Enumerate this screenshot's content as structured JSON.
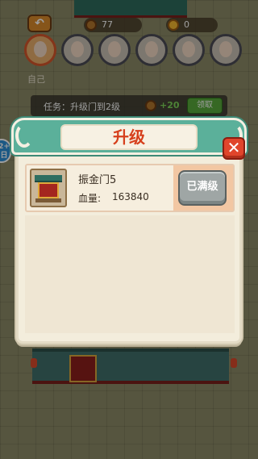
{
  "hud": {
    "back_icon": "arrow-left-icon",
    "coin_amount": "77",
    "gold_amount": "0",
    "self_label": "自己"
  },
  "task": {
    "text": "任务：升级门到2级",
    "reward": "+20",
    "claim_label": "领取"
  },
  "side_badge": {
    "line1": "2+",
    "line2": "日"
  },
  "modal": {
    "title": "升级",
    "close_icon": "close-icon"
  },
  "item": {
    "name": "振金门5",
    "hp_label": "血量:",
    "hp_value": "163840",
    "button_label": "已满级"
  },
  "colors": {
    "header_teal": "#5bb09a",
    "title_red": "#d63f1c",
    "close_red": "#e0452b",
    "maxed_gray": "#9fa6a5",
    "panel_cream": "#f3eddc"
  }
}
